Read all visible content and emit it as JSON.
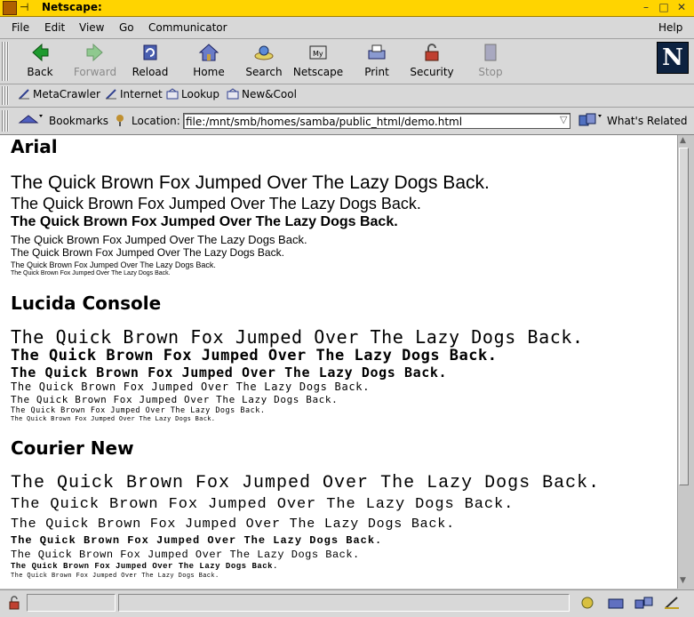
{
  "window": {
    "title": "Netscape:"
  },
  "menu": [
    "File",
    "Edit",
    "View",
    "Go",
    "Communicator",
    "Help"
  ],
  "toolbar": {
    "back": "Back",
    "forward": "Forward",
    "reload": "Reload",
    "home": "Home",
    "search": "Search",
    "netscape": "Netscape",
    "print": "Print",
    "security": "Security",
    "stop": "Stop"
  },
  "personal": [
    "MetaCrawler",
    "Internet",
    "Lookup",
    "New&Cool"
  ],
  "location": {
    "bookmarks": "Bookmarks",
    "label": "Location:",
    "url": "file:/mnt/smb/homes/samba/public_html/demo.html",
    "related": "What's Related"
  },
  "content": {
    "sections": [
      {
        "heading": "Arial",
        "sample": "The Quick Brown Fox Jumped Over The Lazy Dogs Back."
      },
      {
        "heading": "Lucida Console",
        "sample": "The Quick Brown Fox Jumped Over The Lazy Dogs Back."
      },
      {
        "heading": "Courier New",
        "sample": "The Quick Brown Fox Jumped Over The Lazy Dogs Back."
      }
    ]
  },
  "colors": {
    "titlebar": "#ffd400",
    "chrome": "#d8d8d8",
    "logo_bg": "#0d2240"
  }
}
